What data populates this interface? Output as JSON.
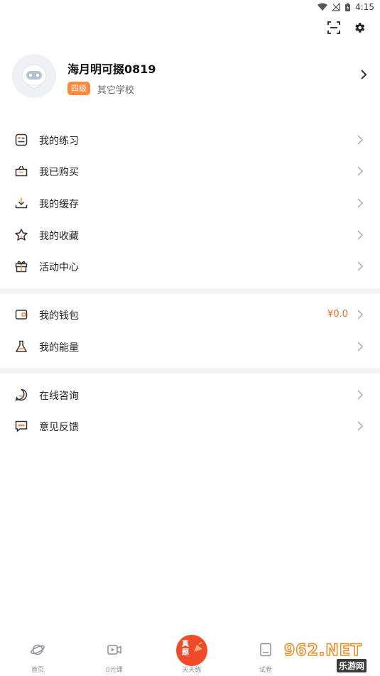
{
  "status_bar": {
    "time": "4:15"
  },
  "profile": {
    "username": "海月明可掇0819",
    "grade": "四级",
    "school": "其它学校"
  },
  "menu_group_1": [
    {
      "label": "我的练习",
      "icon": "practice-icon"
    },
    {
      "label": "我已购买",
      "icon": "basket-icon"
    },
    {
      "label": "我的缓存",
      "icon": "download-icon"
    },
    {
      "label": "我的收藏",
      "icon": "star-icon"
    },
    {
      "label": "活动中心",
      "icon": "gift-icon"
    }
  ],
  "menu_group_2": [
    {
      "label": "我的钱包",
      "icon": "wallet-icon",
      "value": "¥0.0"
    },
    {
      "label": "我的能量",
      "icon": "flask-icon"
    }
  ],
  "menu_group_3": [
    {
      "label": "在线咨询",
      "icon": "chat-smile-icon"
    },
    {
      "label": "意见反馈",
      "icon": "feedback-icon"
    }
  ],
  "tab_bar": {
    "tabs": [
      {
        "label": "首页",
        "icon": "planet-icon"
      },
      {
        "label": "0元课",
        "icon": "video-icon"
      },
      {
        "label": "天天练",
        "icon": "daily-practice-icon"
      },
      {
        "label": "试卷",
        "icon": "paper-icon"
      }
    ],
    "center_badge": "真题"
  },
  "watermark": {
    "main": "962.NET",
    "sub": "乐游网"
  },
  "colors": {
    "accent": "#f26b1d",
    "badge": "#ff8a3d",
    "center_tab": "#ef4a2a",
    "divider": "#f3f4f6"
  }
}
